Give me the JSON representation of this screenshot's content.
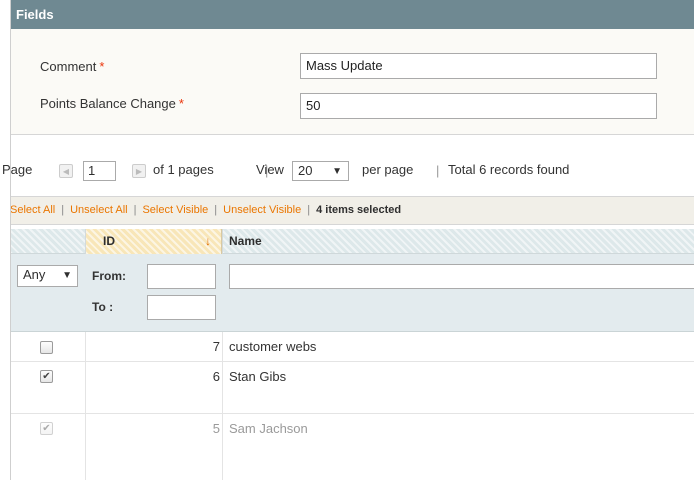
{
  "fields": {
    "title": "Fields",
    "comment_label": "Comment",
    "comment_value": "Mass Update",
    "points_label": "Points Balance Change",
    "points_value": "50",
    "required_mark": "*"
  },
  "pager": {
    "page_label": "Page",
    "prev_arrow": "◀",
    "page_value": "1",
    "next_arrow": "▶",
    "of_pages": "of 1 pages",
    "sep": "|",
    "view_label": "View",
    "view_value": "20",
    "dropdown_arrow": "▼",
    "per_page": "per page",
    "total_records": "Total 6 records found"
  },
  "massaction": {
    "select_all": "Select All",
    "unselect_all": "Unselect All",
    "select_visible": "Select Visible",
    "unselect_visible": "Unselect Visible",
    "sep": "|",
    "selected_count": "4",
    "selected_suffix": "items selected"
  },
  "grid": {
    "columns": {
      "id": "ID",
      "name": "Name",
      "sort_arrow": "↓"
    },
    "filters": {
      "any_value": "Any",
      "any_arrow": "▼",
      "from_label": "From:",
      "to_label": "To :"
    },
    "rows": [
      {
        "checked": false,
        "disabled": false,
        "id": "7",
        "name": "customer webs"
      },
      {
        "checked": true,
        "disabled": false,
        "id": "6",
        "name": "Stan Gibs"
      },
      {
        "checked": true,
        "disabled": true,
        "id": "5",
        "name": "Sam Jachson"
      }
    ],
    "check_glyph": "✔"
  }
}
